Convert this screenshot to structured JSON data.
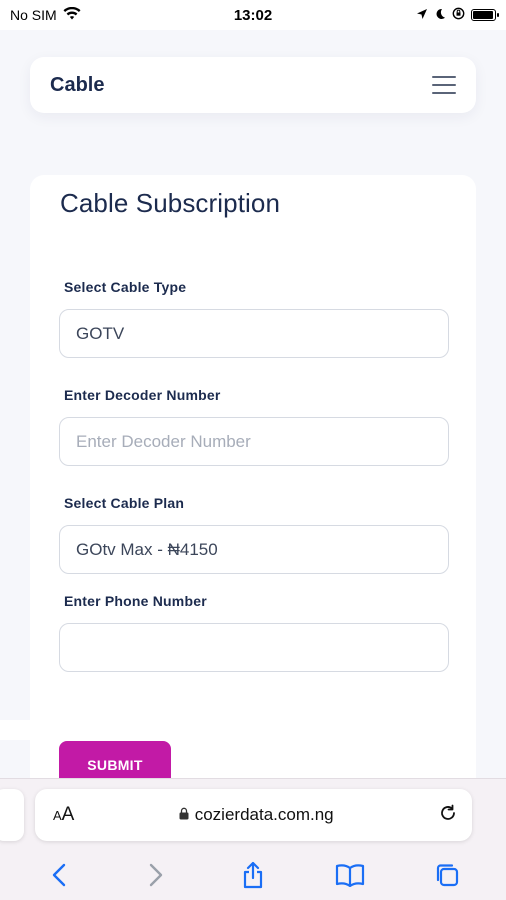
{
  "status_bar": {
    "carrier": "No SIM",
    "time": "13:02",
    "battery_level": 0.95
  },
  "header": {
    "brand": "Cable",
    "menu_icon": "hamburger-icon"
  },
  "form": {
    "title": "Cable Subscription",
    "fields": [
      {
        "label": "Select Cable Type",
        "value": "GOTV",
        "placeholder": ""
      },
      {
        "label": "Enter Decoder Number",
        "value": "",
        "placeholder": "Enter Decoder Number"
      },
      {
        "label": "Select Cable Plan",
        "value": "GOtv Max - ₦4150",
        "placeholder": ""
      },
      {
        "label": "Enter Phone Number",
        "value": "",
        "placeholder": ""
      }
    ],
    "submit_label": "SUBMIT"
  },
  "browser": {
    "text_size_label": "AA",
    "url": "cozierdata.com.ng",
    "icons": [
      "back-icon",
      "forward-icon",
      "share-icon",
      "bookmarks-icon",
      "tabs-icon",
      "reload-icon",
      "lock-icon"
    ]
  },
  "colors": {
    "accent": "#c21aa6",
    "brand_text": "#1c2b4e",
    "ios_blue": "#1a6ef5"
  }
}
